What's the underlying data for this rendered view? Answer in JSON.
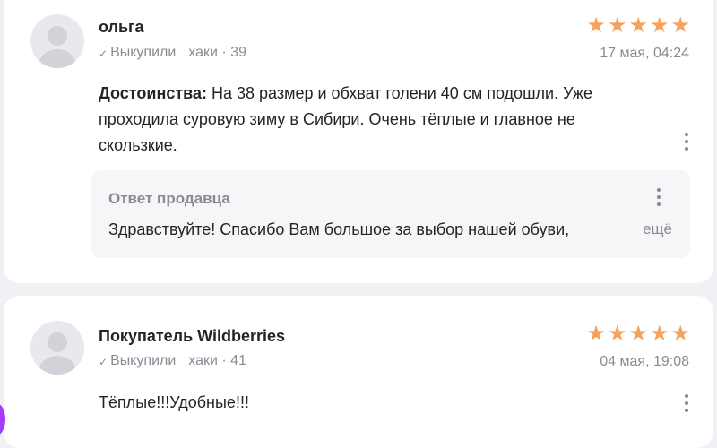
{
  "reviews": [
    {
      "author": "ольга",
      "purchased": "Выкупили",
      "product": "хаки · 39",
      "rating": 5,
      "date": "17 мая, 04:24",
      "text_prefix": "Достоинства:",
      "text": "На 38 размер и обхват голени 40 см подошли. Уже проходила суровую зиму в Сибири. Очень тёплые и главное не скользкие.",
      "seller_reply": {
        "title": "Ответ продавца",
        "text": "Здравствуйте! Спасибо Вам большое за выбор нашей обуви,",
        "more": "ещё"
      }
    },
    {
      "author": "Покупатель Wildberries",
      "purchased": "Выкупили",
      "product": "хаки · 41",
      "rating": 5,
      "date": "04 мая, 19:08",
      "text": "Тёплые!!!Удобные!!!"
    }
  ],
  "icons": {
    "check": "check-icon",
    "star": "star-icon",
    "more": "more-vertical-icon",
    "avatar": "user-avatar-icon"
  },
  "colors": {
    "star": "#f7a25c",
    "muted": "#8b8a94",
    "accent": "#a73afd"
  }
}
